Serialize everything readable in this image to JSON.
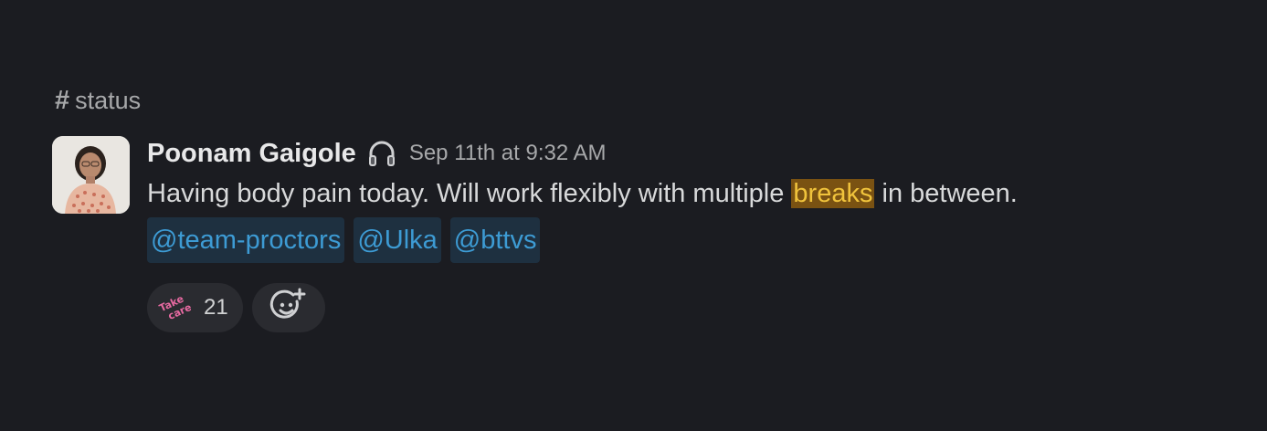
{
  "channel": {
    "hash": "#",
    "name": "status"
  },
  "message": {
    "author": "Poonam Gaigole",
    "status_icon": "headphones-icon",
    "timestamp": "Sep 11th at 9:32 AM",
    "text_before": "Having body pain today. Will work flexibly with multiple ",
    "text_highlight": "breaks",
    "text_after": " in between.",
    "mentions": [
      "@team-proctors",
      "@Ulka",
      "@bttvs"
    ]
  },
  "reactions": [
    {
      "emoji": "take-care-sticker-icon",
      "emoji_text": "Take care",
      "count": "21"
    }
  ],
  "add_reaction_icon": "add-reaction-icon",
  "colors": {
    "background": "#1b1c21",
    "mention_text": "#3d9bd4",
    "mention_bg": "#1e3040",
    "highlight_bg": "#7a5212",
    "highlight_text": "#f0c33c",
    "reaction_bg": "#2a2b30"
  }
}
